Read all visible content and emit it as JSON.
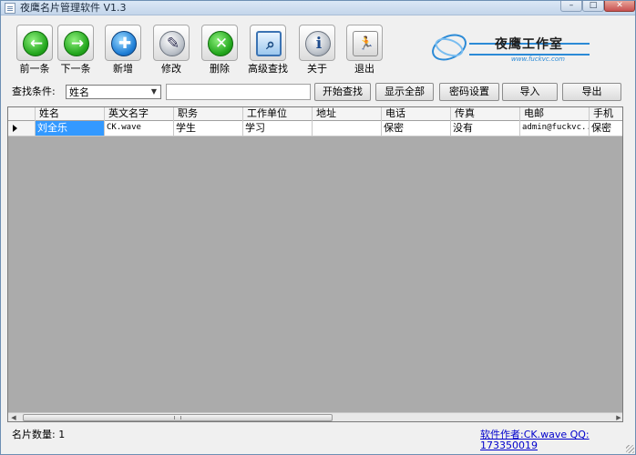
{
  "window": {
    "title": "夜鹰名片管理软件 V1.3",
    "controls": {
      "minimize": "–",
      "maximize": "□",
      "close": "✕"
    }
  },
  "toolbar": [
    {
      "id": "prev",
      "label": "前一条",
      "icon": "arrow-left-icon",
      "glyph": "←",
      "style": "c-green"
    },
    {
      "id": "next",
      "label": "下一条",
      "icon": "arrow-right-icon",
      "glyph": "→",
      "style": "c-green"
    },
    {
      "id": "add",
      "label": "新增",
      "icon": "add-icon",
      "glyph": "✚",
      "style": "c-blue"
    },
    {
      "id": "edit",
      "label": "修改",
      "icon": "edit-icon",
      "glyph": "✎",
      "style": "c-gray"
    },
    {
      "id": "delete",
      "label": "删除",
      "icon": "delete-icon",
      "glyph": "✕",
      "style": "c-green"
    },
    {
      "id": "advanced",
      "label": "高级查找",
      "icon": "magnifier-icon",
      "glyph": "⌕",
      "style": "c-mag"
    },
    {
      "id": "about",
      "label": "关于",
      "icon": "info-icon",
      "glyph": "ℹ",
      "style": "c-gray"
    },
    {
      "id": "exit",
      "label": "退出",
      "icon": "exit-icon",
      "glyph": "🏃",
      "style": "c-exit"
    }
  ],
  "logo": {
    "name": "夜鹰工作室",
    "url": "www.fuckvc.com"
  },
  "search": {
    "label": "查找条件:",
    "field_selected": "姓名",
    "query": "",
    "buttons": {
      "start": "开始查找",
      "show_all": "显示全部",
      "password": "密码设置",
      "import": "导入",
      "export": "导出"
    }
  },
  "grid": {
    "columns": [
      "姓名",
      "英文名字",
      "职务",
      "工作单位",
      "地址",
      "电话",
      "传真",
      "电邮",
      "手机"
    ],
    "rows": [
      [
        "刘全乐",
        "CK.wave",
        "学生",
        "学习",
        "",
        "保密",
        "没有",
        "admin@fuckvc...",
        "保密"
      ]
    ]
  },
  "status": {
    "count_label": "名片数量:",
    "count": "1",
    "author": "软件作者:CK.wave QQ: 173350019"
  },
  "colors": {
    "selection": "#3399ff",
    "link": "#0000cc",
    "grid_bg": "#ababab"
  }
}
